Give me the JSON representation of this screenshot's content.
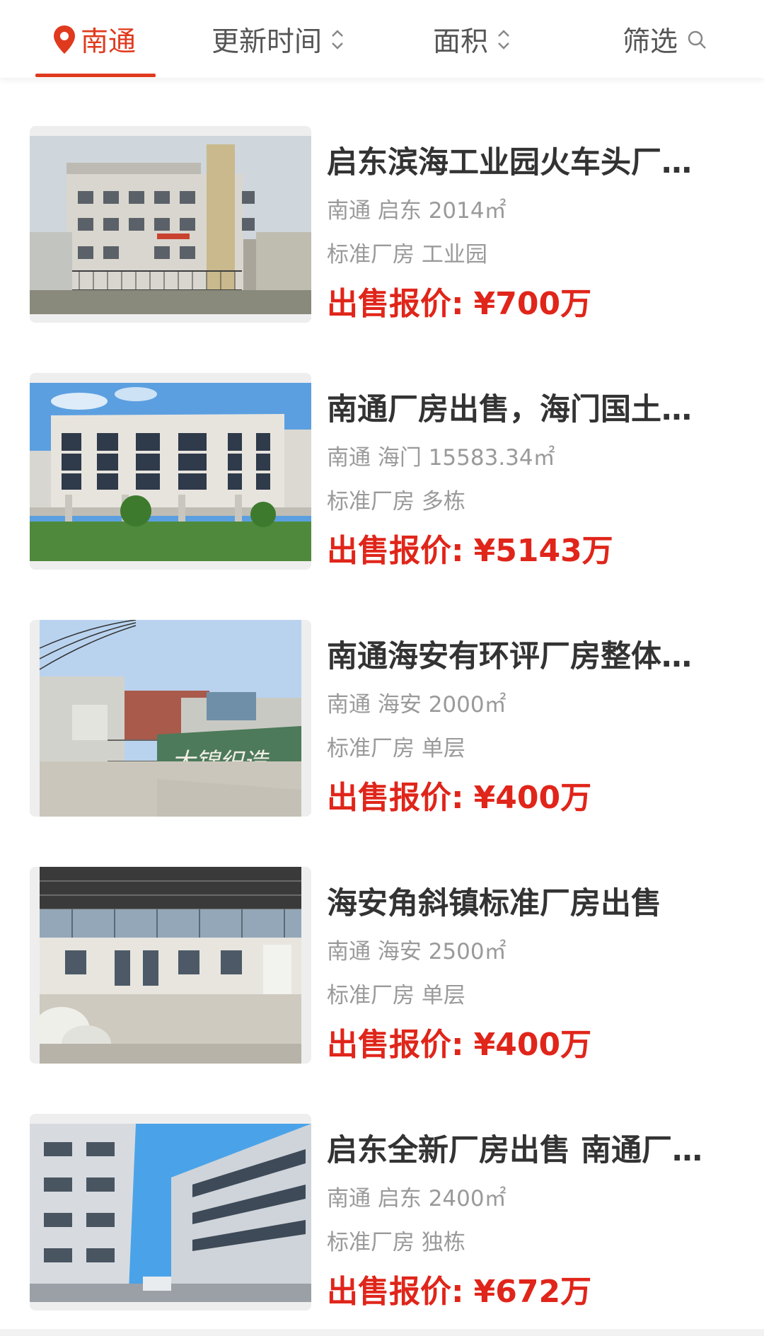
{
  "topbar": {
    "city": "南通",
    "sort_time": "更新时间",
    "sort_area": "面积",
    "filter": "筛选",
    "accent_color": "#e03a1e"
  },
  "listings": [
    {
      "title": "启东滨海工业园火车头厂…",
      "meta": "南通 启东 2014㎡",
      "tags": "标准厂房 工业园",
      "price_label": "出售报价:",
      "price_value": "¥700万"
    },
    {
      "title": "南通厂房出售，海门国土…",
      "meta": "南通 海门 15583.34㎡",
      "tags": "标准厂房 多栋",
      "price_label": "出售报价:",
      "price_value": "¥5143万"
    },
    {
      "title": "南通海安有环评厂房整体…",
      "meta": "南通 海安 2000㎡",
      "tags": "标准厂房 单层",
      "price_label": "出售报价:",
      "price_value": "¥400万"
    },
    {
      "title": "海安角斜镇标准厂房出售",
      "meta": "南通 海安 2500㎡",
      "tags": "标准厂房 单层",
      "price_label": "出售报价:",
      "price_value": "¥400万"
    },
    {
      "title": "启东全新厂房出售 南通厂…",
      "meta": "南通 启东 2400㎡",
      "tags": "标准厂房 独栋",
      "price_label": "出售报价:",
      "price_value": "¥672万"
    }
  ],
  "signage_text": "大锦织造"
}
